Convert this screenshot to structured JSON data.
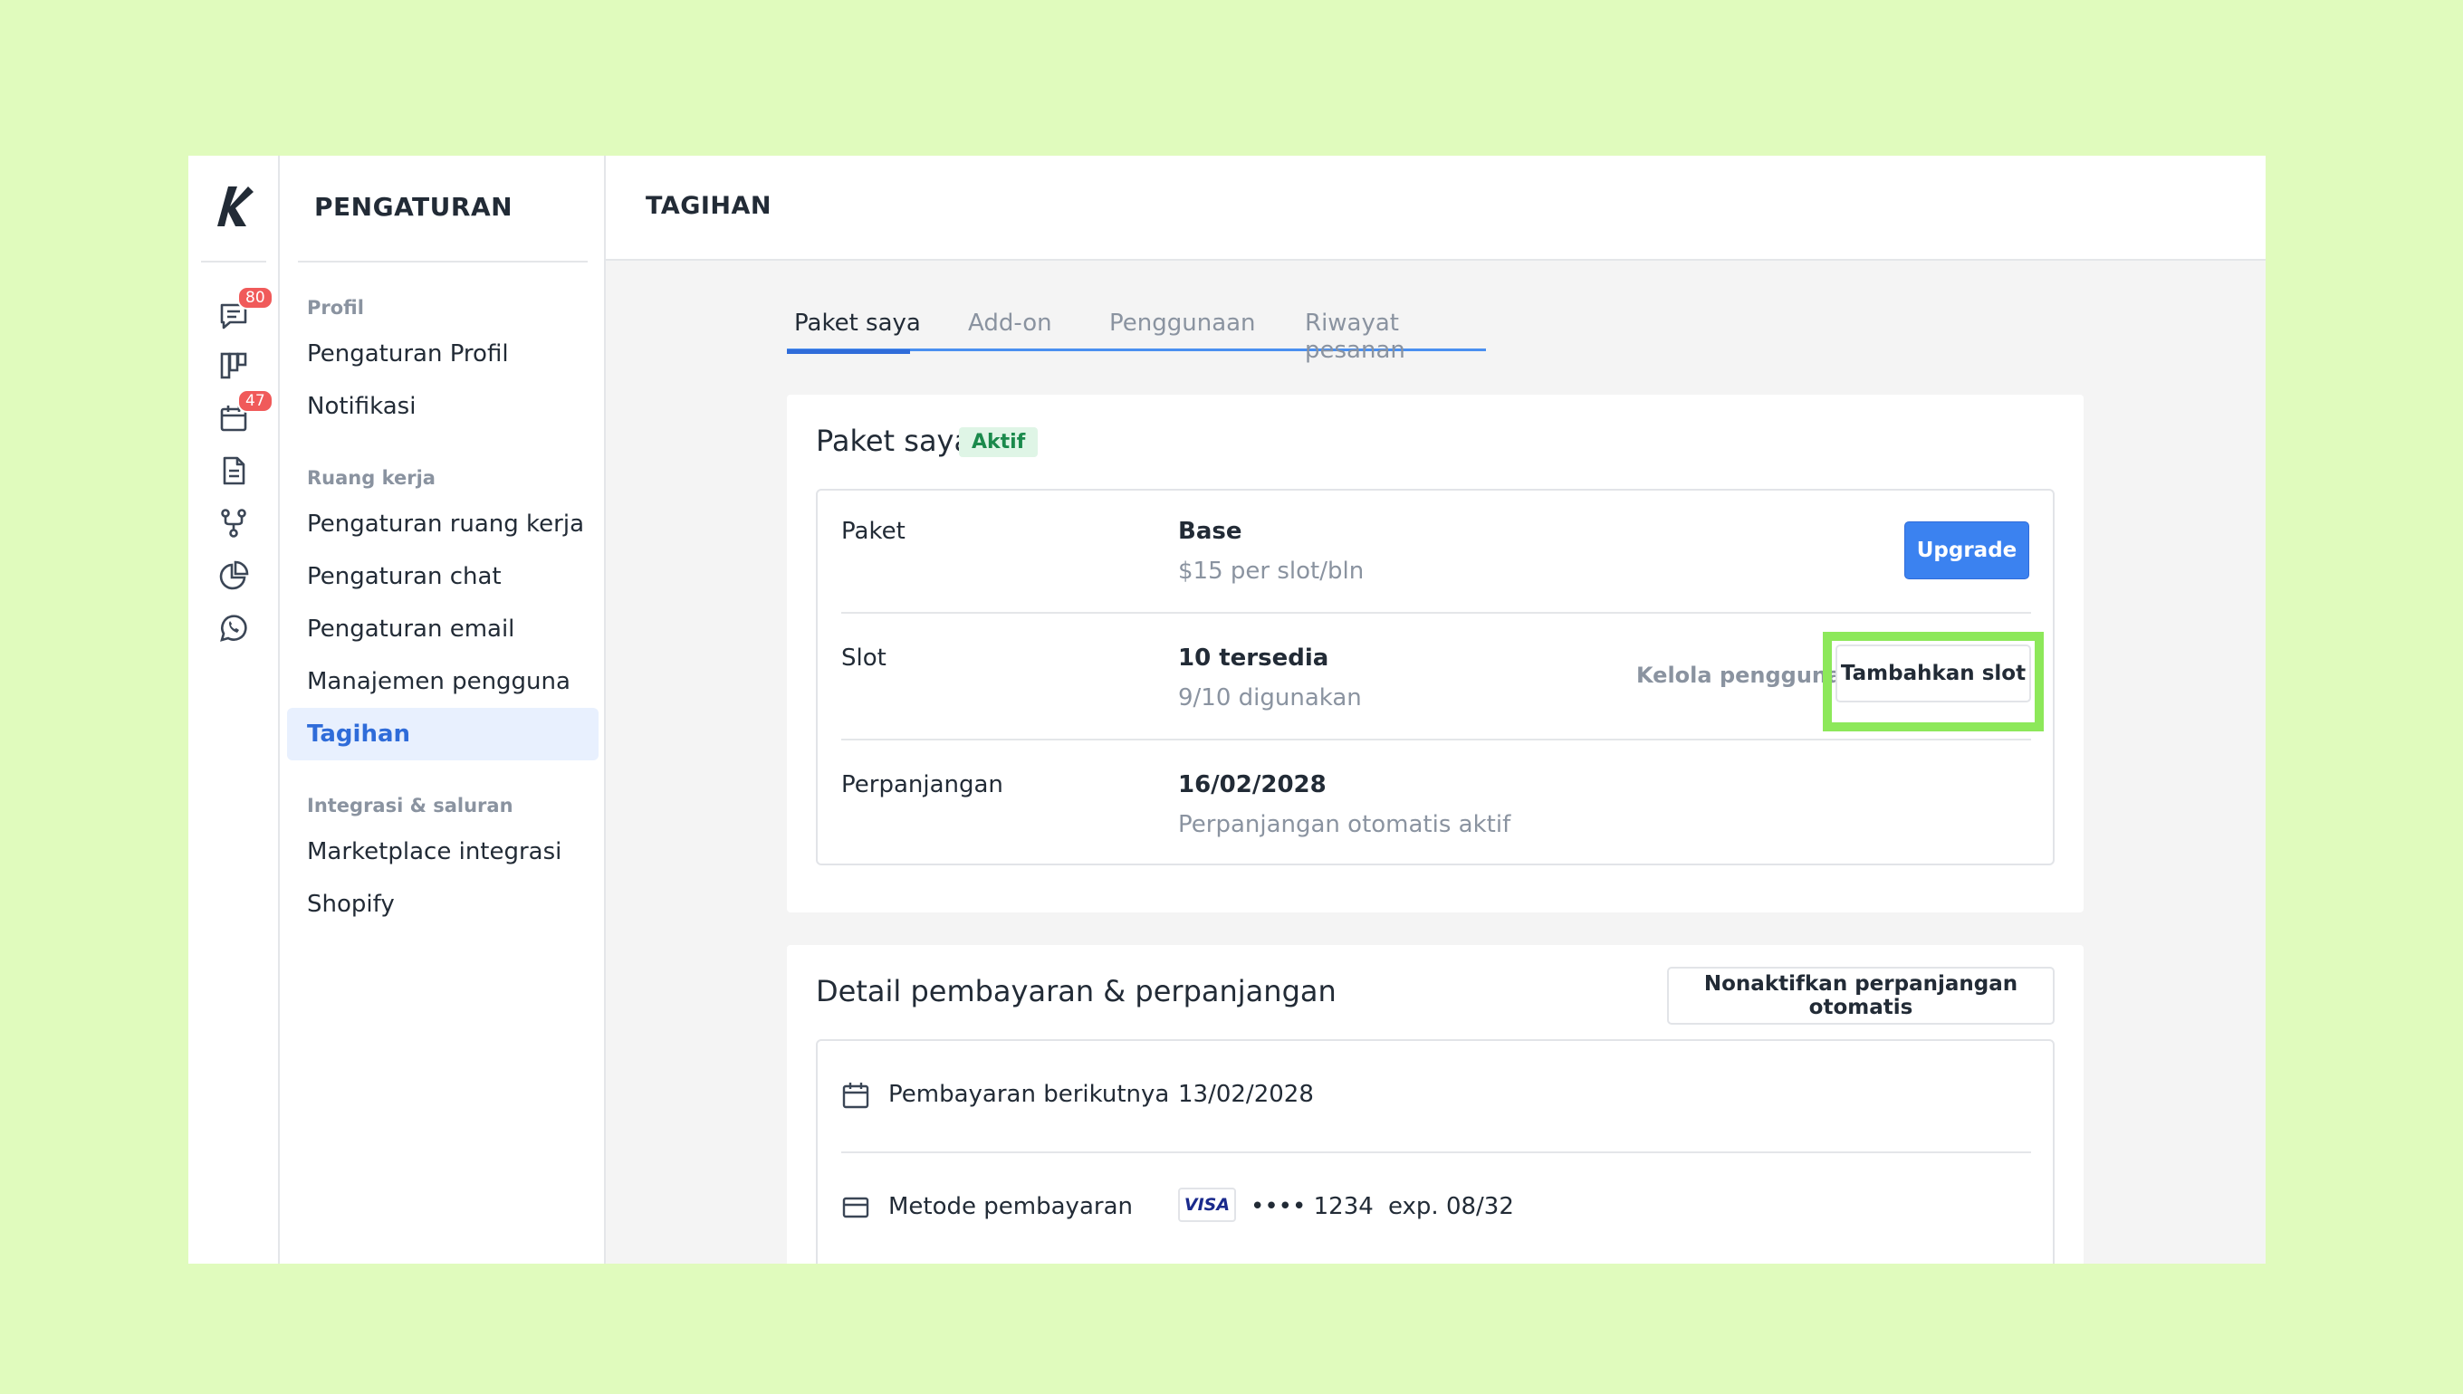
{
  "rail": {
    "chat_badge": "80",
    "calendar_badge": "47"
  },
  "sidebar": {
    "title": "PENGATURAN",
    "groups": [
      {
        "label": "Profil",
        "items": [
          "Pengaturan Profil",
          "Notifikasi"
        ]
      },
      {
        "label": "Ruang kerja",
        "items": [
          "Pengaturan ruang kerja",
          "Pengaturan chat",
          "Pengaturan email",
          "Manajemen pengguna",
          "Tagihan"
        ]
      },
      {
        "label": "Integrasi & saluran",
        "items": [
          "Marketplace integrasi",
          "Shopify"
        ]
      }
    ],
    "active_item": "Tagihan"
  },
  "header": {
    "title": "TAGIHAN"
  },
  "tabs": [
    "Paket saya",
    "Add-on",
    "Penggunaan",
    "Riwayat pesanan"
  ],
  "plan_card": {
    "title": "Paket saya",
    "status": "Aktif",
    "rows": [
      {
        "label": "Paket",
        "value": "Base",
        "sub": "$15 per slot/bln"
      },
      {
        "label": "Slot",
        "value": "10 tersedia",
        "sub": "9/10 digunakan"
      },
      {
        "label": "Perpanjangan",
        "value": "16/02/2028",
        "sub": "Perpanjangan otomatis aktif"
      }
    ],
    "upgrade_label": "Upgrade",
    "manage_users_label": "Kelola pengguna",
    "add_slot_label": "Tambahkan slot"
  },
  "payment_card": {
    "title": "Detail pembayaran & perpanjangan",
    "deactivate_label": "Nonaktifkan perpanjangan otomatis",
    "next_payment_label": "Pembayaran berikutnya",
    "next_payment_value": "13/02/2028",
    "method_label": "Metode pembayaran",
    "card_brand": "VISA",
    "card_number": "•••• 1234",
    "card_exp": "exp. 08/32"
  },
  "colors": {
    "background": "#e0fbbd",
    "accent": "#3b82f0",
    "highlight": "#8de85a",
    "active_badge": "#1b8a4c"
  }
}
